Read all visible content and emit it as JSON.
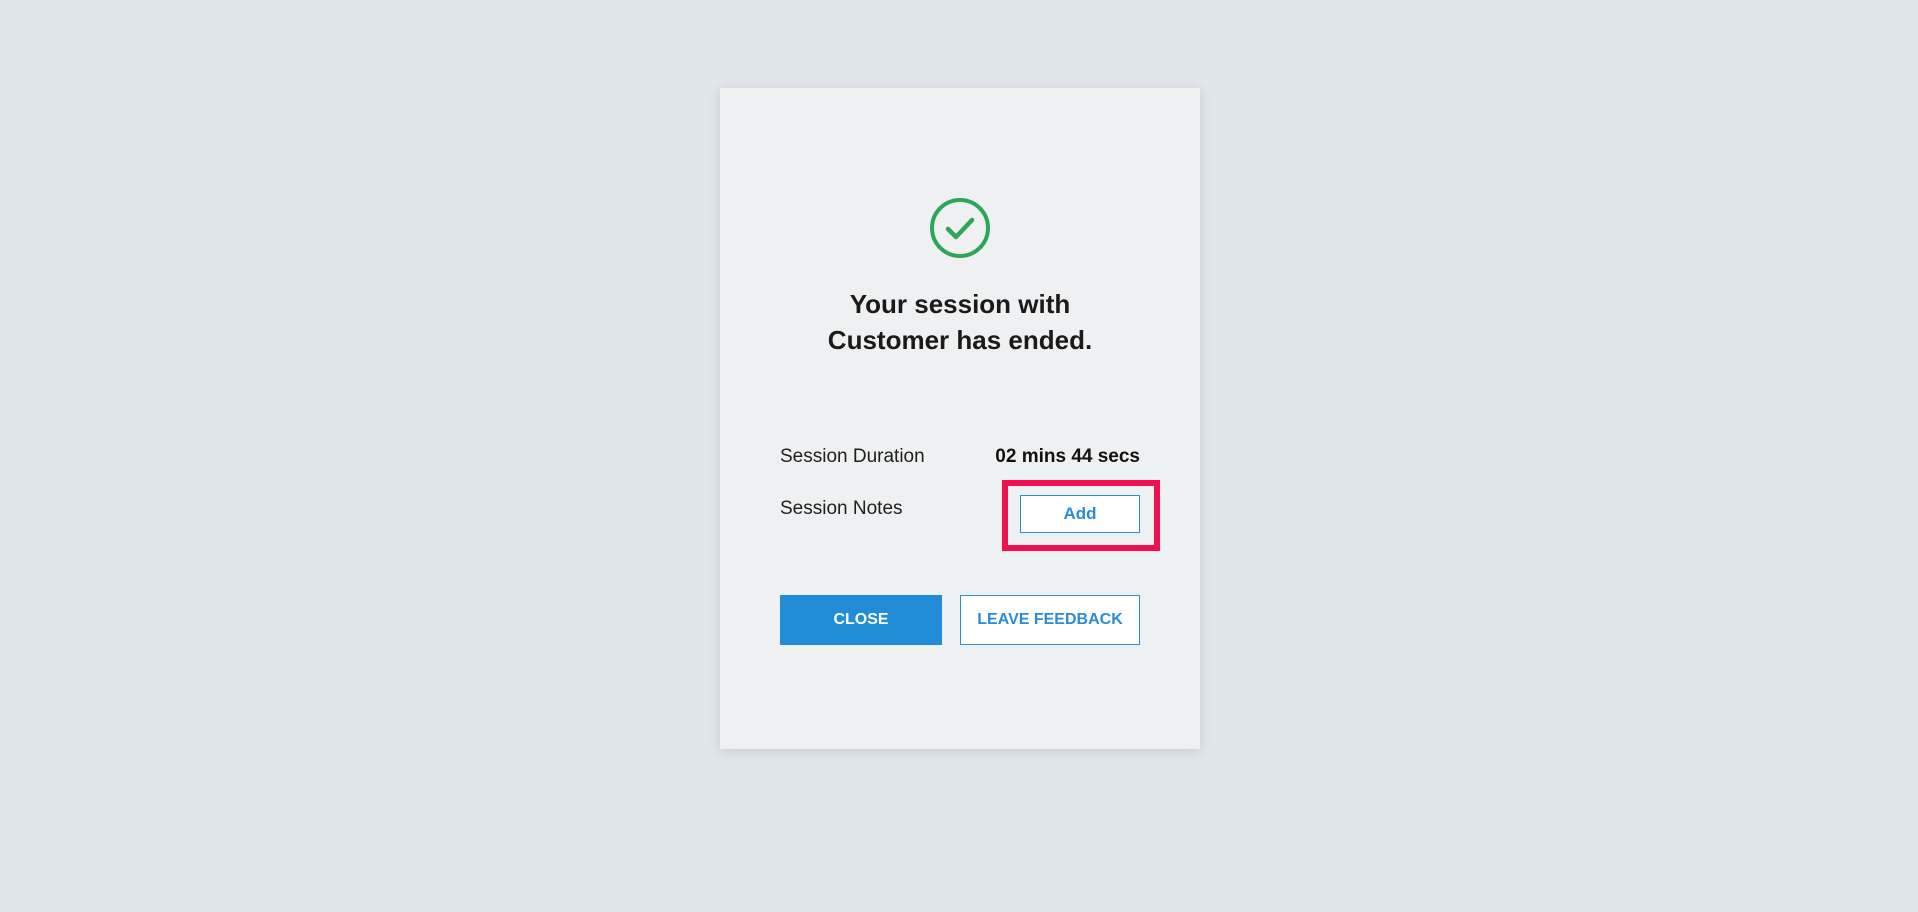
{
  "dialog": {
    "title_line1": "Your session with",
    "title_line2": "Customer has ended.",
    "success_icon": "check-circle-icon",
    "success_color": "#2ea55a"
  },
  "details": {
    "duration_label": "Session Duration",
    "duration_value": "02 mins 44 secs",
    "notes_label": "Session Notes",
    "notes_add_label": "Add"
  },
  "actions": {
    "close_label": "CLOSE",
    "feedback_label": "LEAVE FEEDBACK"
  },
  "colors": {
    "accent": "#218cd8",
    "highlight": "#f0104f",
    "background": "#e1e6ea",
    "dialog": "#eff0f1"
  }
}
